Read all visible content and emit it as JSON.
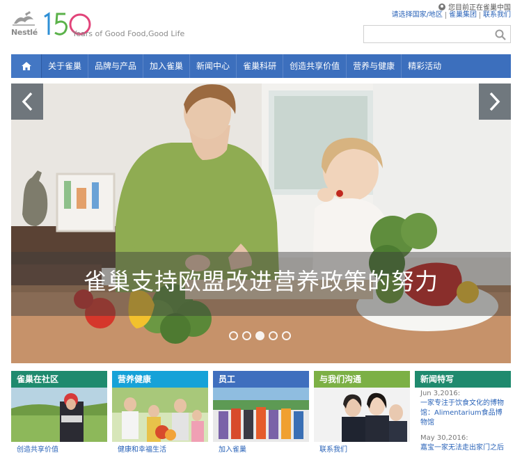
{
  "header": {
    "logo_word": "Nestlé",
    "anniversary_number": "150",
    "anniversary_tagline": "Years of Good Food,Good Life",
    "location_text": "您目前正在雀巢中国",
    "top_links": [
      "请选择国家/地区",
      "雀巢集团",
      "联系我们"
    ],
    "search_placeholder": ""
  },
  "nav": {
    "items": [
      "关于雀巢",
      "品牌与产品",
      "加入雀巢",
      "新闻中心",
      "雀巢科研",
      "创造共享价值",
      "营养与健康",
      "精彩活动"
    ]
  },
  "hero": {
    "caption": "雀巢支持欧盟改进营养政策的努力",
    "slide_count": 5,
    "active_slide": 3
  },
  "tiles": [
    {
      "title": "雀巢在社区",
      "link": "创造共享价值",
      "color": "#1f8a6e"
    },
    {
      "title": "营养健康",
      "link": "健康和幸福生活",
      "color": "#16a2d8"
    },
    {
      "title": "员工",
      "link": "加入雀巢",
      "color": "#3f6fbe"
    },
    {
      "title": "与我们沟通",
      "link": "联系我们",
      "color": "#7cb045"
    }
  ],
  "news": {
    "title": "新闻特写",
    "color": "#1f8a6e",
    "items": [
      {
        "date": "Jun 3,2016:",
        "title": "一家专注于饮食文化的博物馆：Alimentarium食品博物馆"
      },
      {
        "date": "May 30,2016:",
        "title": "嘉宝一家无法走出家门之后"
      }
    ]
  },
  "colors": {
    "nav": "#3c6fbd",
    "link": "#2a63b8"
  }
}
